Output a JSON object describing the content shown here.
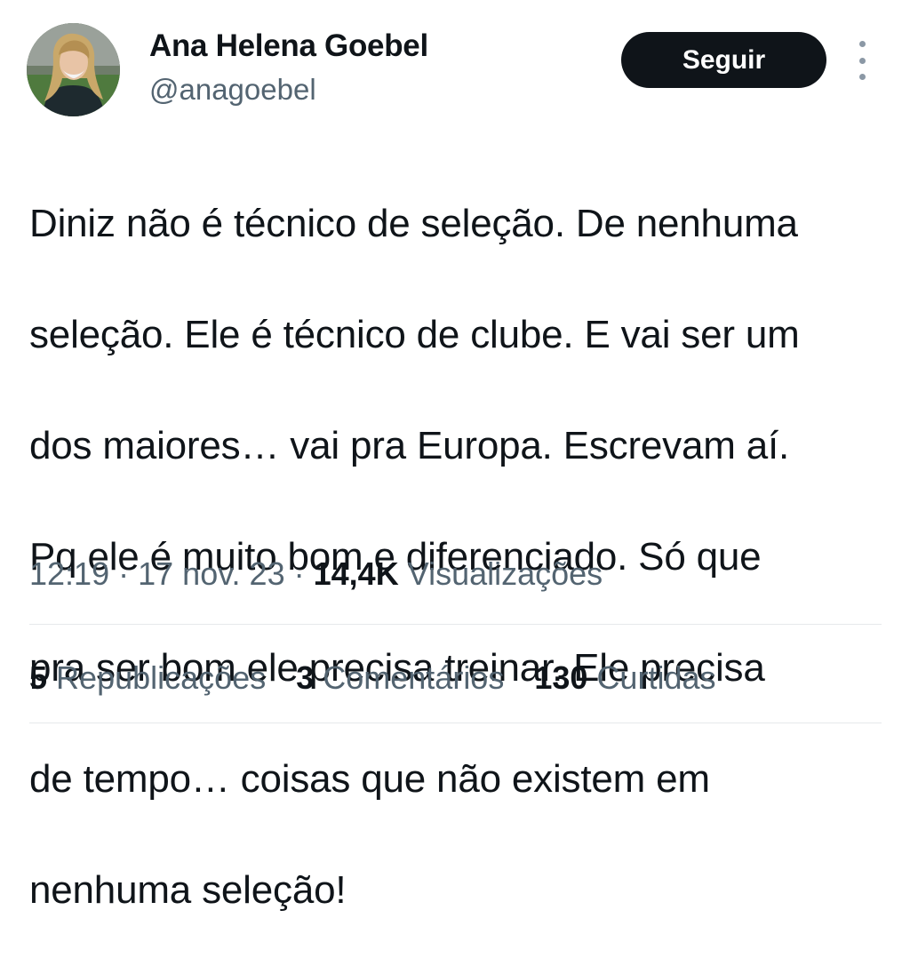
{
  "author": {
    "name": "Ana Helena Goebel",
    "handle": "@anagoebel",
    "avatar_icon": "profile-photo"
  },
  "actions": {
    "follow_label": "Seguir",
    "more_icon": "vertical-ellipsis-icon"
  },
  "tweet": {
    "lines": [
      "Diniz não é técnico de seleção. De nenhuma",
      "seleção. Ele é técnico de clube. E vai ser um",
      "dos maiores… vai pra Europa. Escrevam aí.",
      "Pq ele é muito bom e diferenciado. Só que",
      "pra ser bom ele precisa treinar. Ele precisa",
      "de tempo… coisas que não existem em",
      "nenhuma seleção!"
    ]
  },
  "meta": {
    "time": "12:19",
    "separator": "·",
    "date": "17 nov. 23",
    "views_count": "14,4K",
    "views_label": "Visualizações"
  },
  "stats": {
    "reposts_count": "5",
    "reposts_label": "Republicações",
    "comments_count": "3",
    "comments_label": "Comentários",
    "likes_count": "130",
    "likes_label": "Curtidas"
  },
  "colors": {
    "text_primary": "#0f1419",
    "text_secondary": "#536471",
    "button_bg": "#0f1419",
    "divider": "#e6e9eb"
  }
}
